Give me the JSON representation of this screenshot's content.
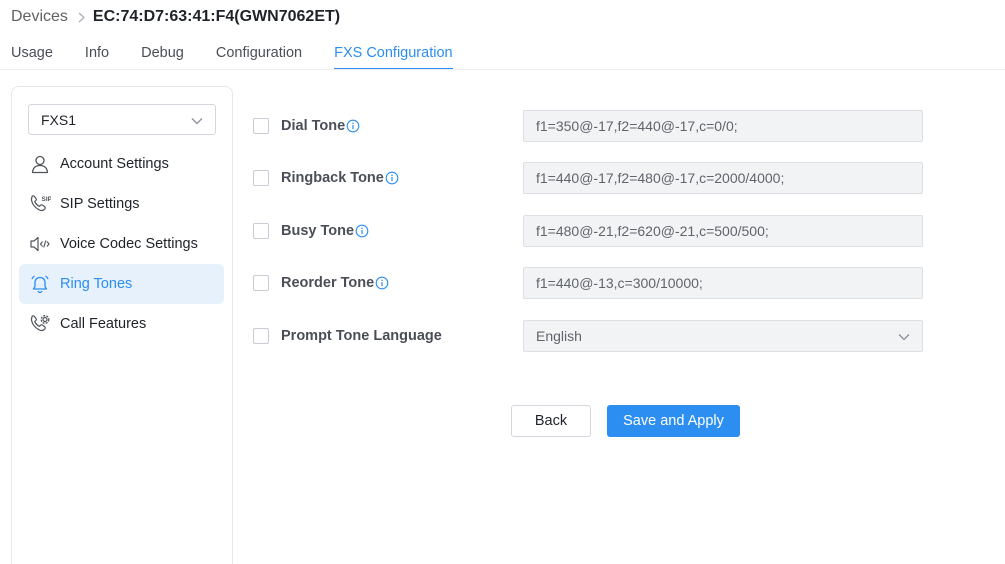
{
  "breadcrumb": {
    "root": "Devices",
    "current": "EC:74:D7:63:41:F4(GWN7062ET)"
  },
  "tabs": [
    {
      "label": "Usage"
    },
    {
      "label": "Info"
    },
    {
      "label": "Debug"
    },
    {
      "label": "Configuration"
    },
    {
      "label": "FXS Configuration",
      "active": true
    }
  ],
  "sidebar": {
    "port_select": "FXS1",
    "items": [
      {
        "label": "Account Settings",
        "icon": "user-icon"
      },
      {
        "label": "SIP Settings",
        "icon": "sip-phone-icon"
      },
      {
        "label": "Voice Codec Settings",
        "icon": "speaker-code-icon"
      },
      {
        "label": "Ring Tones",
        "icon": "bell-icon",
        "active": true
      },
      {
        "label": "Call Features",
        "icon": "phone-gear-icon"
      }
    ]
  },
  "form": {
    "dial_tone": {
      "label": "Dial Tone",
      "value": "f1=350@-17,f2=440@-17,c=0/0;"
    },
    "ringback_tone": {
      "label": "Ringback Tone",
      "value": "f1=440@-17,f2=480@-17,c=2000/4000;"
    },
    "busy_tone": {
      "label": "Busy Tone",
      "value": "f1=480@-21,f2=620@-21,c=500/500;"
    },
    "reorder_tone": {
      "label": "Reorder Tone",
      "value": "f1=440@-13,c=300/10000;"
    },
    "prompt_tone_language": {
      "label": "Prompt Tone Language",
      "value": "English"
    }
  },
  "buttons": {
    "back": "Back",
    "save": "Save and Apply"
  },
  "colors": {
    "accent": "#2b8ef0",
    "active_bg": "#e6f1fc",
    "field_bg": "#f2f3f5"
  }
}
